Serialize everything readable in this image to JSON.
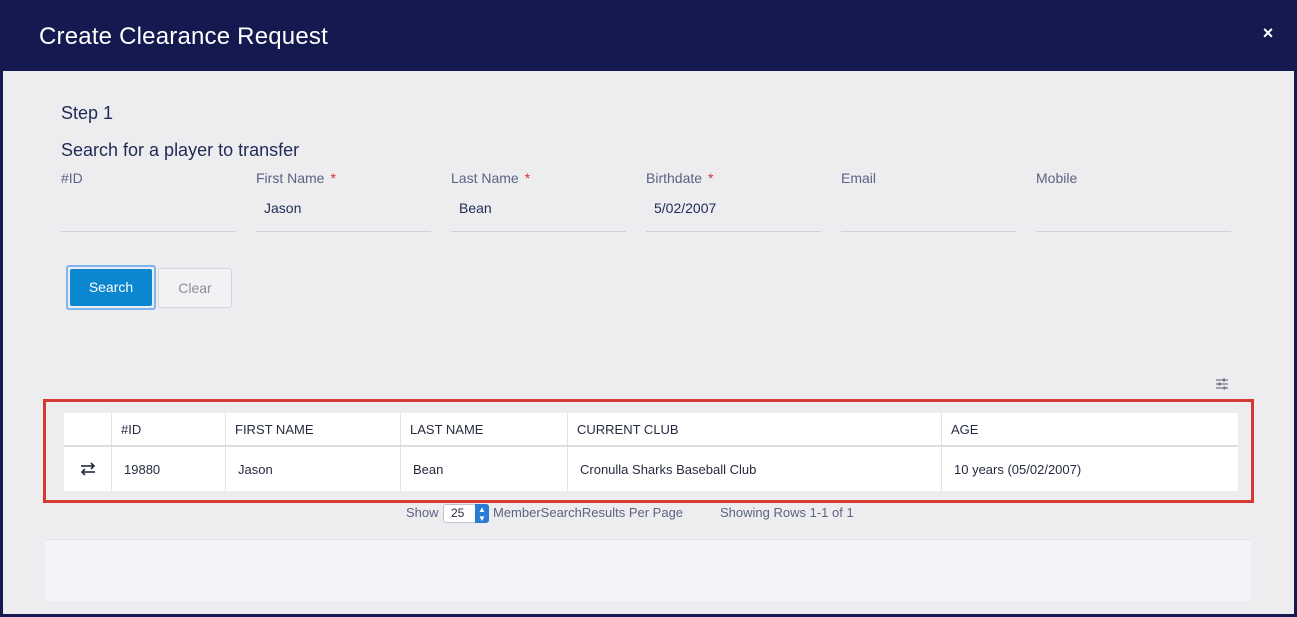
{
  "modal": {
    "title": "Create Clearance Request",
    "close_label": "×"
  },
  "step": {
    "title": "Step 1",
    "subtitle": "Search for a player to transfer"
  },
  "fields": [
    {
      "label": "#ID",
      "required": false,
      "value": ""
    },
    {
      "label": "First Name",
      "required": true,
      "value": "Jason"
    },
    {
      "label": "Last Name",
      "required": true,
      "value": "Bean"
    },
    {
      "label": "Birthdate",
      "required": true,
      "value": "5/02/2007"
    },
    {
      "label": "Email",
      "required": false,
      "value": ""
    },
    {
      "label": "Mobile",
      "required": false,
      "value": ""
    }
  ],
  "required_marker": "*",
  "buttons": {
    "search": "Search",
    "clear": "Clear"
  },
  "table": {
    "columns": [
      "",
      "#ID",
      "FIRST NAME",
      "LAST NAME",
      "CURRENT CLUB",
      "AGE"
    ],
    "rows": [
      {
        "transfer_icon": "⇄",
        "id": "19880",
        "first_name": "Jason",
        "last_name": "Bean",
        "club": "Cronulla Sharks Baseball Club",
        "age": "10 years (05/02/2007)"
      }
    ]
  },
  "pager": {
    "show_label": "Show",
    "per_page_value": "25",
    "per_page_label": "MemberSearchResults Per Page",
    "count_label": "Showing Rows 1-1 of 1"
  },
  "icons": {
    "settings": "sliders-icon",
    "transfer": "swap-arrows-icon",
    "close": "close-icon"
  },
  "colors": {
    "header_bg": "#141a4f",
    "primary_button": "#0a87d0",
    "highlight_border": "#d63a35",
    "required": "#d22f2f"
  }
}
